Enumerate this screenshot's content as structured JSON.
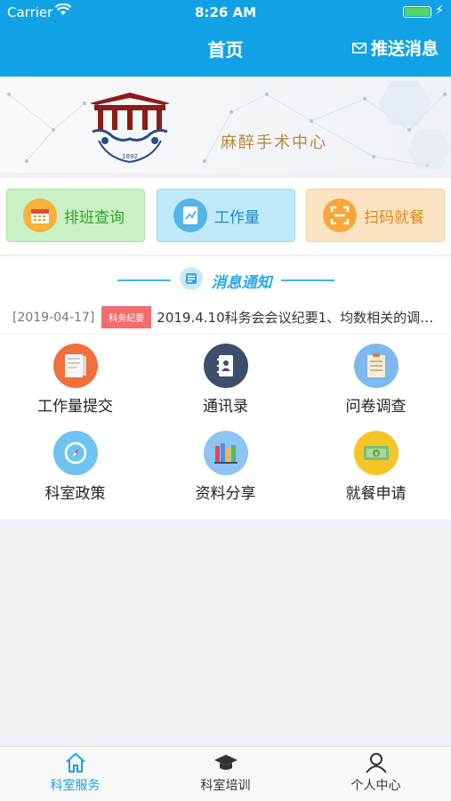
{
  "status": {
    "carrier": "Carrier",
    "time": "8:26 AM"
  },
  "nav": {
    "title": "首页",
    "push": "推送消息"
  },
  "banner": {
    "text": "麻醉手术中心",
    "year": "1892"
  },
  "quick": [
    {
      "label": "排班查询",
      "icon": "calendar-icon"
    },
    {
      "label": "工作量",
      "icon": "chart-icon"
    },
    {
      "label": "扫码就餐",
      "icon": "scan-icon"
    }
  ],
  "notice": {
    "title": "消息通知",
    "date": "[2019-04-17]",
    "tag": "科务纪要",
    "text": "2019.4.10科务会会议纪要1、均数相关的调整..."
  },
  "grid": [
    {
      "label": "工作量提交",
      "icon": "notebook-icon"
    },
    {
      "label": "通讯录",
      "icon": "contacts-icon"
    },
    {
      "label": "问卷调查",
      "icon": "survey-icon"
    },
    {
      "label": "科室政策",
      "icon": "compass-icon"
    },
    {
      "label": "资料分享",
      "icon": "books-icon"
    },
    {
      "label": "就餐申请",
      "icon": "money-icon"
    }
  ],
  "tabs": [
    {
      "label": "科室服务",
      "icon": "home-icon",
      "active": true
    },
    {
      "label": "科室培训",
      "icon": "graduation-cap-icon",
      "active": false
    },
    {
      "label": "个人中心",
      "icon": "person-icon",
      "active": false
    }
  ],
  "colors": {
    "primary": "#11a2e6",
    "accent_red": "#f26d6d"
  }
}
